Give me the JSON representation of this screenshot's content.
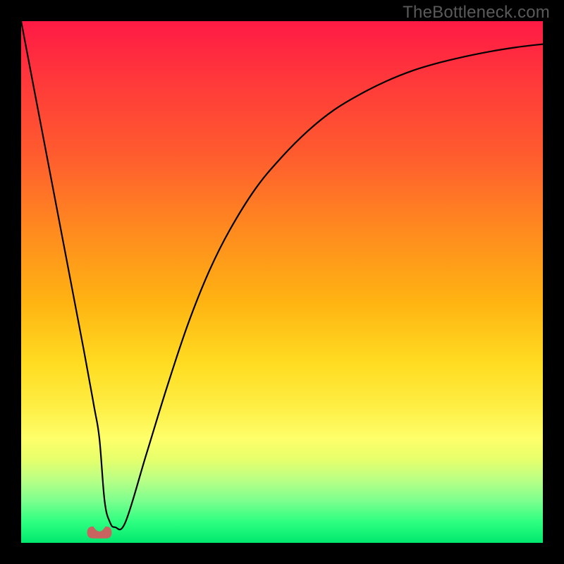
{
  "watermark": "TheBottleneck.com",
  "chart_data": {
    "type": "line",
    "title": "",
    "xlabel": "",
    "ylabel": "",
    "xlim": [
      0,
      100
    ],
    "ylim": [
      0,
      100
    ],
    "series": [
      {
        "name": "curve",
        "x": [
          0,
          4,
          8,
          12,
          14,
          15,
          16,
          17,
          18,
          20,
          24,
          28,
          32,
          36,
          40,
          45,
          50,
          55,
          60,
          65,
          70,
          75,
          80,
          85,
          90,
          95,
          100
        ],
        "values": [
          100,
          79,
          58,
          37,
          26,
          20,
          8,
          4,
          3,
          4,
          17,
          30,
          42,
          52,
          60,
          68,
          74,
          79,
          83,
          86,
          88.5,
          90.5,
          92,
          93.2,
          94.2,
          95,
          95.6
        ]
      }
    ],
    "annotations": [
      {
        "name": "highlight-blob",
        "x": 15,
        "y": 2,
        "shape": "rounded",
        "color": "#c8645f"
      }
    ],
    "background_gradient": {
      "type": "vertical",
      "stops": [
        {
          "pos": 0.0,
          "color": "#ff1a45"
        },
        {
          "pos": 0.4,
          "color": "#ff8a1f"
        },
        {
          "pos": 0.7,
          "color": "#ffe634"
        },
        {
          "pos": 0.88,
          "color": "#b9ff86"
        },
        {
          "pos": 1.0,
          "color": "#01e86f"
        }
      ]
    }
  }
}
